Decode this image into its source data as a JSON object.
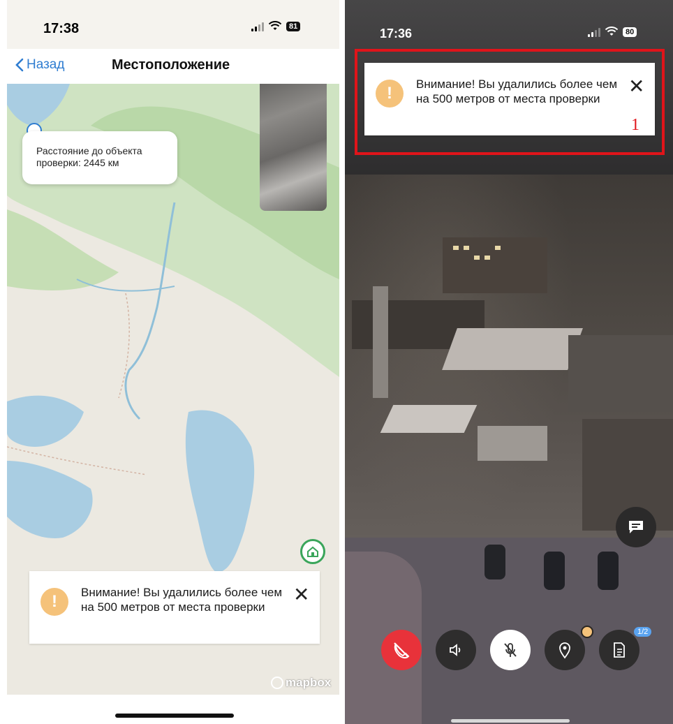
{
  "left_screen": {
    "status_time": "17:38",
    "battery": "81",
    "back_label": "Назад",
    "title": "Местоположение",
    "distance_text": "Расстояние до объекта проверки: 2445 км",
    "alert": {
      "text": "Внимание! Вы удалились более чем на 500 метров от места проверки",
      "close": "✕"
    },
    "attribution": "mapbox"
  },
  "right_screen": {
    "status_time": "17:36",
    "battery": "80",
    "alert": {
      "text": "Внимание! Вы удалились более чем на 500 метров от места проверки",
      "close": "✕"
    },
    "annotation_number": "1",
    "controls": [
      {
        "name": "end-call",
        "icon": "phone-slash-icon",
        "color": "#e8323a"
      },
      {
        "name": "speaker",
        "icon": "speaker-icon",
        "color": "#2e2d2d"
      },
      {
        "name": "mute",
        "icon": "mic-off-icon",
        "color": "#ffffff"
      },
      {
        "name": "location",
        "icon": "location-pin-icon",
        "color": "#2e2d2d"
      },
      {
        "name": "document",
        "icon": "document-icon",
        "color": "#2e2d2d"
      }
    ],
    "document_badge": "1/2"
  },
  "colors": {
    "accent_blue": "#2f7dd1",
    "warning": "#f5c27a",
    "annotation_red": "#e0141a"
  }
}
